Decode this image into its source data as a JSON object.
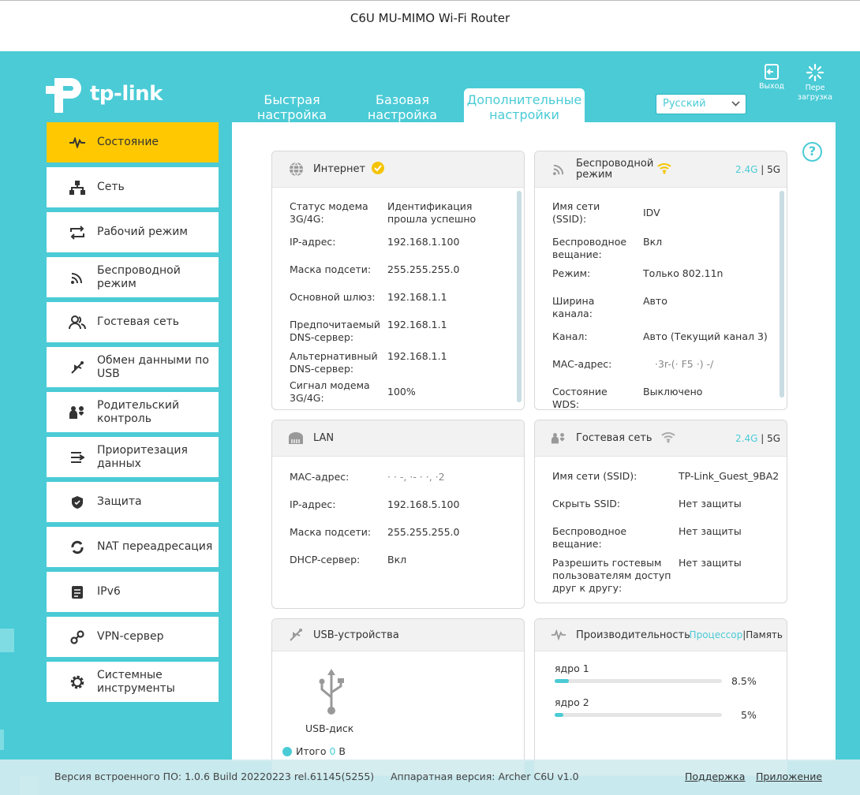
{
  "window_title": "C6U MU-MIMO Wi-Fi Router",
  "brand": "tp-link",
  "colors": {
    "accent": "#4acbd6",
    "active_menu": "#ffc800",
    "ok": "#f5c400"
  },
  "tabs": [
    {
      "label_line1": "Быстрая",
      "label_line2": "настройка"
    },
    {
      "label_line1": "Базовая",
      "label_line2": "настройка"
    },
    {
      "label_line1": "Дополнительные",
      "label_line2": "настройки"
    }
  ],
  "language": "Русский",
  "top_icons": {
    "logout": "Выход",
    "reboot_line1": "Пере",
    "reboot_line2": "загрузка"
  },
  "sidebar": [
    {
      "line1": "Состояние",
      "line2": "",
      "icon": "activity-icon"
    },
    {
      "line1": "Сеть",
      "line2": "",
      "icon": "network-icon"
    },
    {
      "line1": "Рабочий режим",
      "line2": "",
      "icon": "mode-switch-icon"
    },
    {
      "line1": "Беспроводной",
      "line2": "режим",
      "icon": "wireless-icon"
    },
    {
      "line1": "Гостевая сеть",
      "line2": "",
      "icon": "guest-icon"
    },
    {
      "line1": "Обмен данными по",
      "line2": "USB",
      "icon": "usb-icon"
    },
    {
      "line1": "Родительский",
      "line2": "контроль",
      "icon": "parental-icon"
    },
    {
      "line1": "Приоритезация",
      "line2": "данных",
      "icon": "qos-icon"
    },
    {
      "line1": "Защита",
      "line2": "",
      "icon": "shield-icon"
    },
    {
      "line1": "NAT переадресация",
      "line2": "",
      "icon": "nat-icon"
    },
    {
      "line1": "IPv6",
      "line2": "",
      "icon": "ipv6-icon"
    },
    {
      "line1": "VPN-сервер",
      "line2": "",
      "icon": "vpn-icon"
    },
    {
      "line1": "Системные",
      "line2": "инструменты",
      "icon": "gear-icon"
    }
  ],
  "internet": {
    "title": "Интернет",
    "rows": [
      {
        "k1": "Статус модема",
        "k2": "3G/4G:",
        "v1": "Идентификация",
        "v2": "прошла успешно"
      },
      {
        "k1": "IP-адрес:",
        "k2": "",
        "v1": "192.168.1.100",
        "v2": ""
      },
      {
        "k1": "Маска подсети:",
        "k2": "",
        "v1": "255.255.255.0",
        "v2": ""
      },
      {
        "k1": "Основной шлюз:",
        "k2": "",
        "v1": "192.168.1.1",
        "v2": ""
      },
      {
        "k1": "Предпочитаемый",
        "k2": "DNS-сервер:",
        "v1": "192.168.1.1",
        "v2": ""
      },
      {
        "k1": "Альтернативный",
        "k2": "DNS-сервер:",
        "v1": "192.168.1.1",
        "v2": ""
      },
      {
        "k1": "Сигнал модема",
        "k2": "3G/4G:",
        "v1": "100%",
        "v2": ""
      }
    ]
  },
  "wireless": {
    "title_line1": "Беспроводной",
    "title_line2": "режим",
    "band_24": "2.4G",
    "band_sep": " | ",
    "band_5": "5G",
    "rows": [
      {
        "k1": "Имя сети",
        "k2": "(SSID):",
        "v1": "IDV"
      },
      {
        "k1": "Беспроводное",
        "k2": "вещание:",
        "v1": "Вкл"
      },
      {
        "k1": "Режим:",
        "k2": "",
        "v1": "Только 802.11n"
      },
      {
        "k1": "Ширина",
        "k2": "канала:",
        "v1": "Авто"
      },
      {
        "k1": "Канал:",
        "k2": "",
        "v1": "Авто (Текущий канал 3)"
      },
      {
        "k1": "MAC-адрес:",
        "k2": "",
        "v1": "·3r-(· F5 ·) -/"
      },
      {
        "k1": "Состояние",
        "k2": "WDS:",
        "v1": "Выключено"
      }
    ]
  },
  "lan": {
    "title": "LAN",
    "rows": [
      {
        "k": "MAC-адрес:",
        "v": "·   · -, ·- ·  ·, ·2"
      },
      {
        "k": "IP-адрес:",
        "v": "192.168.5.100"
      },
      {
        "k": "Маска подсети:",
        "v": "255.255.255.0"
      },
      {
        "k": "DHCP-сервер:",
        "v": "Вкл"
      }
    ]
  },
  "guest": {
    "title": "Гостевая сеть",
    "band_24": "2.4G",
    "band_sep": " | ",
    "band_5": "5G",
    "rows": [
      {
        "k1": "Имя сети (SSID):",
        "k2": "",
        "k3": "",
        "v": "TP-Link_Guest_9BA2"
      },
      {
        "k1": "Скрыть SSID:",
        "k2": "",
        "k3": "",
        "v": "Нет защиты"
      },
      {
        "k1": "Беспроводное",
        "k2": "вещание:",
        "k3": "",
        "v": "Нет защиты"
      },
      {
        "k1": "Разрешить гостевым",
        "k2": "пользователям доступ",
        "k3": "друг к другу:",
        "v": "Нет защиты"
      }
    ]
  },
  "usb": {
    "title": "USB-устройства",
    "device": "USB-диск",
    "total_label": "Итого",
    "total_value": "0",
    "total_unit": "В"
  },
  "performance": {
    "title": "Производительность",
    "tab_cpu": "Процессор",
    "tab_sep": "|",
    "tab_mem": "Память",
    "cores": [
      {
        "label": "ядро 1",
        "value_text": "8.5%",
        "value": 8.5
      },
      {
        "label": "ядро 2",
        "value_text": "5%",
        "value": 5
      }
    ]
  },
  "footer": {
    "firmware": "Версия встроенного ПО: 1.0.6 Build 20220223 rel.61145(5255)",
    "hardware": "Аппаратная версия: Archer C6U v1.0",
    "support": "Поддержка",
    "app": "Приложение"
  }
}
